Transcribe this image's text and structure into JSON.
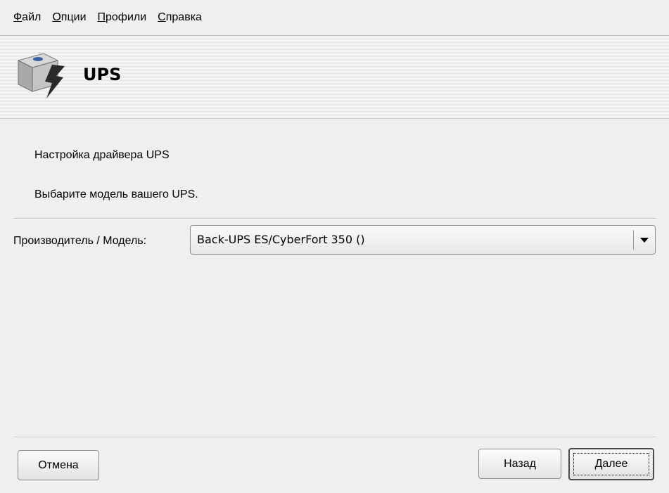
{
  "menu": [
    {
      "mnemonic": "Ф",
      "rest": "айл"
    },
    {
      "mnemonic": "О",
      "rest": "пции"
    },
    {
      "mnemonic": "П",
      "rest": "рофили"
    },
    {
      "mnemonic": "С",
      "rest": "правка"
    }
  ],
  "header": {
    "title": "UPS",
    "icon": "ups-device-icon"
  },
  "content": {
    "heading": "Настройка драйвера UPS",
    "instruction": "Выбарите модель вашего UPS.",
    "model_label": "Производитель / Модель:",
    "model_value": "Back-UPS ES/CyberFort 350 ()"
  },
  "buttons": {
    "cancel": "Отмена",
    "back": "Назад",
    "next": "Далее"
  }
}
